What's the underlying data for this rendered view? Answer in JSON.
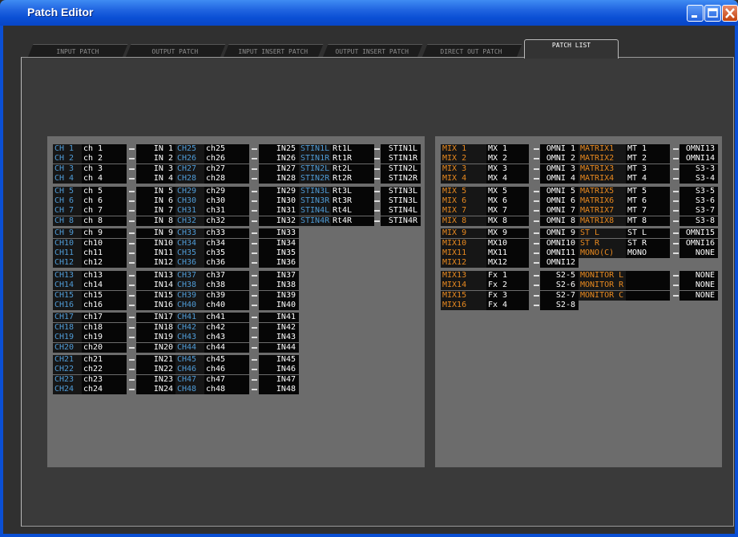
{
  "window": {
    "title": "Patch Editor"
  },
  "tabs": [
    "INPUT PATCH",
    "OUTPUT PATCH",
    "INPUT INSERT PATCH",
    "OUTPUT INSERT PATCH",
    "DIRECT OUT PATCH",
    "PATCH LIST"
  ],
  "active_tab": "PATCH LIST",
  "colors": {
    "input_label": "#4f9bd6",
    "output_label": "#e8891f"
  },
  "input_columns": [
    [
      [
        "CH 1",
        "ch 1",
        "IN 1"
      ],
      [
        "CH 2",
        "ch 2",
        "IN 2"
      ],
      [
        "CH 3",
        "ch 3",
        "IN 3"
      ],
      [
        "CH 4",
        "ch 4",
        "IN 4"
      ],
      [
        "CH 5",
        "ch 5",
        "IN 5"
      ],
      [
        "CH 6",
        "ch 6",
        "IN 6"
      ],
      [
        "CH 7",
        "ch 7",
        "IN 7"
      ],
      [
        "CH 8",
        "ch 8",
        "IN 8"
      ],
      [
        "CH 9",
        "ch 9",
        "IN 9"
      ],
      [
        "CH10",
        "ch10",
        "IN10"
      ],
      [
        "CH11",
        "ch11",
        "IN11"
      ],
      [
        "CH12",
        "ch12",
        "IN12"
      ],
      [
        "CH13",
        "ch13",
        "IN13"
      ],
      [
        "CH14",
        "ch14",
        "IN14"
      ],
      [
        "CH15",
        "ch15",
        "IN15"
      ],
      [
        "CH16",
        "ch16",
        "IN16"
      ],
      [
        "CH17",
        "ch17",
        "IN17"
      ],
      [
        "CH18",
        "ch18",
        "IN18"
      ],
      [
        "CH19",
        "ch19",
        "IN19"
      ],
      [
        "CH20",
        "ch20",
        "IN20"
      ],
      [
        "CH21",
        "ch21",
        "IN21"
      ],
      [
        "CH22",
        "ch22",
        "IN22"
      ],
      [
        "CH23",
        "ch23",
        "IN23"
      ],
      [
        "CH24",
        "ch24",
        "IN24"
      ]
    ],
    [
      [
        "CH25",
        "ch25",
        "IN25"
      ],
      [
        "CH26",
        "ch26",
        "IN26"
      ],
      [
        "CH27",
        "ch27",
        "IN27"
      ],
      [
        "CH28",
        "ch28",
        "IN28"
      ],
      [
        "CH29",
        "ch29",
        "IN29"
      ],
      [
        "CH30",
        "ch30",
        "IN30"
      ],
      [
        "CH31",
        "ch31",
        "IN31"
      ],
      [
        "CH32",
        "ch32",
        "IN32"
      ],
      [
        "CH33",
        "ch33",
        "IN33"
      ],
      [
        "CH34",
        "ch34",
        "IN34"
      ],
      [
        "CH35",
        "ch35",
        "IN35"
      ],
      [
        "CH36",
        "ch36",
        "IN36"
      ],
      [
        "CH37",
        "ch37",
        "IN37"
      ],
      [
        "CH38",
        "ch38",
        "IN38"
      ],
      [
        "CH39",
        "ch39",
        "IN39"
      ],
      [
        "CH40",
        "ch40",
        "IN40"
      ],
      [
        "CH41",
        "ch41",
        "IN41"
      ],
      [
        "CH42",
        "ch42",
        "IN42"
      ],
      [
        "CH43",
        "ch43",
        "IN43"
      ],
      [
        "CH44",
        "ch44",
        "IN44"
      ],
      [
        "CH45",
        "ch45",
        "IN45"
      ],
      [
        "CH46",
        "ch46",
        "IN46"
      ],
      [
        "CH47",
        "ch47",
        "IN47"
      ],
      [
        "CH48",
        "ch48",
        "IN48"
      ]
    ],
    [
      [
        "STIN1L",
        "Rt1L",
        "STIN1L"
      ],
      [
        "STIN1R",
        "Rt1R",
        "STIN1R"
      ],
      [
        "STIN2L",
        "Rt2L",
        "STIN2L"
      ],
      [
        "STIN2R",
        "Rt2R",
        "STIN2R"
      ],
      [
        "STIN3L",
        "Rt3L",
        "STIN3L"
      ],
      [
        "STIN3R",
        "Rt3R",
        "STIN3L"
      ],
      [
        "STIN4L",
        "Rt4L",
        "STIN4L"
      ],
      [
        "STIN4R",
        "Rt4R",
        "STIN4R"
      ]
    ]
  ],
  "output_columns": [
    [
      [
        "MIX 1",
        "MX 1",
        "OMNI 1"
      ],
      [
        "MIX 2",
        "MX 2",
        "OMNI 2"
      ],
      [
        "MIX 3",
        "MX 3",
        "OMNI 3"
      ],
      [
        "MIX 4",
        "MX 4",
        "OMNI 4"
      ],
      [
        "MIX 5",
        "MX 5",
        "OMNI 5"
      ],
      [
        "MIX 6",
        "MX 6",
        "OMNI 6"
      ],
      [
        "MIX 7",
        "MX 7",
        "OMNI 7"
      ],
      [
        "MIX 8",
        "MX 8",
        "OMNI 8"
      ],
      [
        "MIX 9",
        "MX 9",
        "OMNI 9"
      ],
      [
        "MIX10",
        "MX10",
        "OMNI10"
      ],
      [
        "MIX11",
        "MX11",
        "OMNI11"
      ],
      [
        "MIX12",
        "MX12",
        "OMNI12"
      ],
      [
        "MIX13",
        "Fx 1",
        "S2-5"
      ],
      [
        "MIX14",
        "Fx 2",
        "S2-6"
      ],
      [
        "MIX15",
        "Fx 3",
        "S2-7"
      ],
      [
        "MIX16",
        "Fx 4",
        "S2-8"
      ]
    ],
    [
      [
        "MATRIX1",
        "MT 1",
        "OMNI13"
      ],
      [
        "MATRIX2",
        "MT 2",
        "OMNI14"
      ],
      [
        "MATRIX3",
        "MT 3",
        "S3-3"
      ],
      [
        "MATRIX4",
        "MT 4",
        "S3-4"
      ],
      [
        "MATRIX5",
        "MT 5",
        "S3-5"
      ],
      [
        "MATRIX6",
        "MT 6",
        "S3-6"
      ],
      [
        "MATRIX7",
        "MT 7",
        "S3-7"
      ],
      [
        "MATRIX8",
        "MT 8",
        "S3-8"
      ],
      [
        "ST L",
        "ST L",
        "OMNI15"
      ],
      [
        "ST R",
        "ST R",
        "OMNI16"
      ],
      [
        "MONO(C)",
        "MONO",
        "NONE"
      ],
      [
        "",
        "",
        ""
      ],
      [
        "MONITOR L",
        "",
        "NONE"
      ],
      [
        "MONITOR R",
        "",
        "NONE"
      ],
      [
        "MONITOR C",
        "",
        "NONE"
      ]
    ]
  ]
}
